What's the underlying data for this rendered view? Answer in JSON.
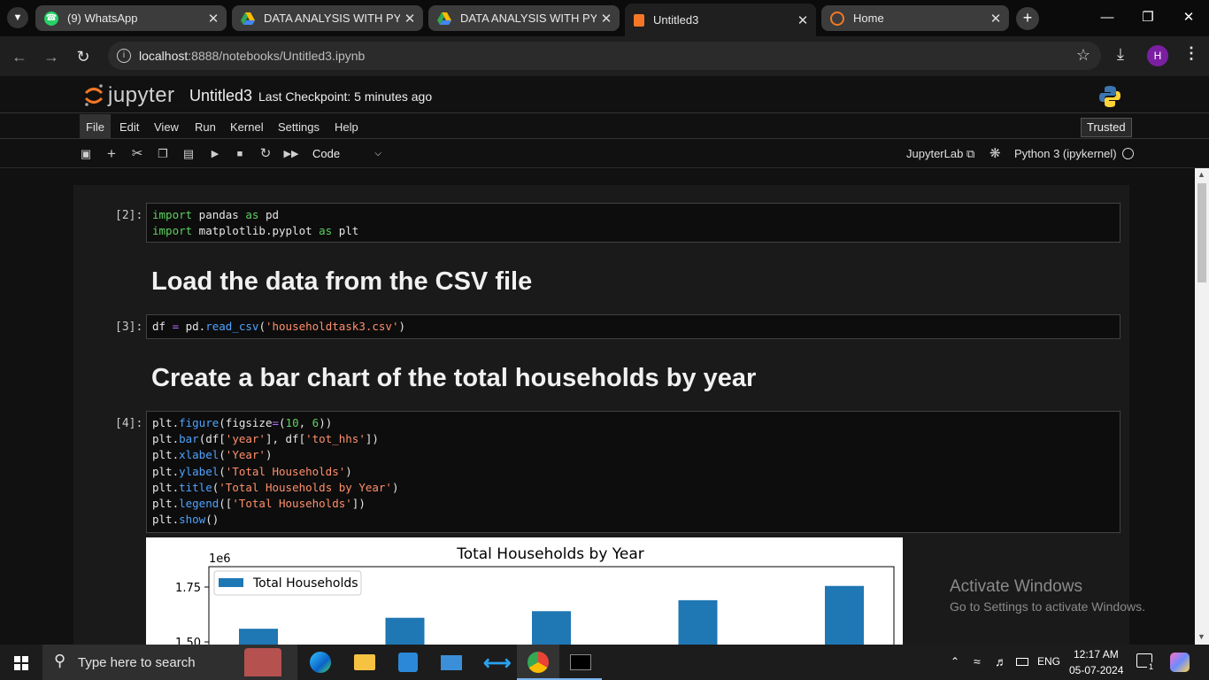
{
  "browser": {
    "tabs": [
      {
        "title": "(9) WhatsApp",
        "icon": "whatsapp-icon"
      },
      {
        "title": "DATA ANALYSIS WITH PYTHO",
        "icon": "google-drive-icon"
      },
      {
        "title": "DATA ANALYSIS WITH PYTHO",
        "icon": "google-drive-icon"
      },
      {
        "title": "Untitled3",
        "icon": "jupyter-book-icon"
      },
      {
        "title": "Home",
        "icon": "jupyter-icon"
      }
    ],
    "url_host": "localhost",
    "url_rest": ":8888/notebooks/Untitled3.ipynb",
    "profile_initial": "H"
  },
  "jupyter": {
    "logo_text": "jupyter",
    "notebook_name": "Untitled3",
    "checkpoint": "Last Checkpoint: 5 minutes ago",
    "trusted": "Trusted",
    "menu": [
      "File",
      "Edit",
      "View",
      "Run",
      "Kernel",
      "Settings",
      "Help"
    ],
    "cell_type": "Code",
    "jupyterlab_link": "JupyterLab",
    "kernel_name": "Python 3 (ipykernel)"
  },
  "cells": {
    "c2_prompt": "[2]:",
    "c3_prompt": "[3]:",
    "c4_prompt": "[4]:",
    "md1": "Load the data from the CSV file",
    "md2": "Create a bar chart of the total households by year"
  },
  "chart_data": {
    "type": "bar",
    "title": "Total Households by Year",
    "offset_label": "1e6",
    "legend": [
      "Total Households"
    ],
    "legend_position": "top-left",
    "ytick_labels": [
      "1.75",
      "1.50"
    ],
    "values": [
      1.56,
      1.61,
      1.64,
      1.69,
      1.755
    ],
    "ylim_visible": [
      1.48,
      1.8
    ],
    "bar_color": "#1f77b4"
  },
  "watermark": {
    "line1": "Activate Windows",
    "line2": "Go to Settings to activate Windows."
  },
  "taskbar": {
    "search_placeholder": "Type here to search",
    "lang": "ENG",
    "time": "12:17 AM",
    "date": "05-07-2024",
    "notif_count": "1"
  }
}
